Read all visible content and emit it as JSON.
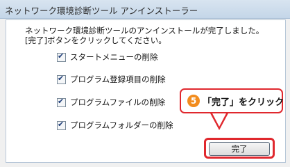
{
  "window": {
    "title": "ネットワーク環境診断ツール アンインストーラー"
  },
  "message": {
    "line1": "ネットワーク環境診断ツールのアンインストールが完了しました。",
    "line2": "[完了]ボタンをクリックしてください。"
  },
  "checklist": [
    {
      "label": "スタートメニューの削除",
      "checked": true
    },
    {
      "label": "プログラム登録項目の削除",
      "checked": true
    },
    {
      "label": "プログラムファイルの削除",
      "checked": true
    },
    {
      "label": "プログラムフォルダーの削除",
      "checked": true
    }
  ],
  "callout": {
    "step_number": "5",
    "text": "「完了」をクリック",
    "accent": "#e0282e",
    "number_color": "#f28c1e"
  },
  "buttons": {
    "finish_label": "完了"
  }
}
